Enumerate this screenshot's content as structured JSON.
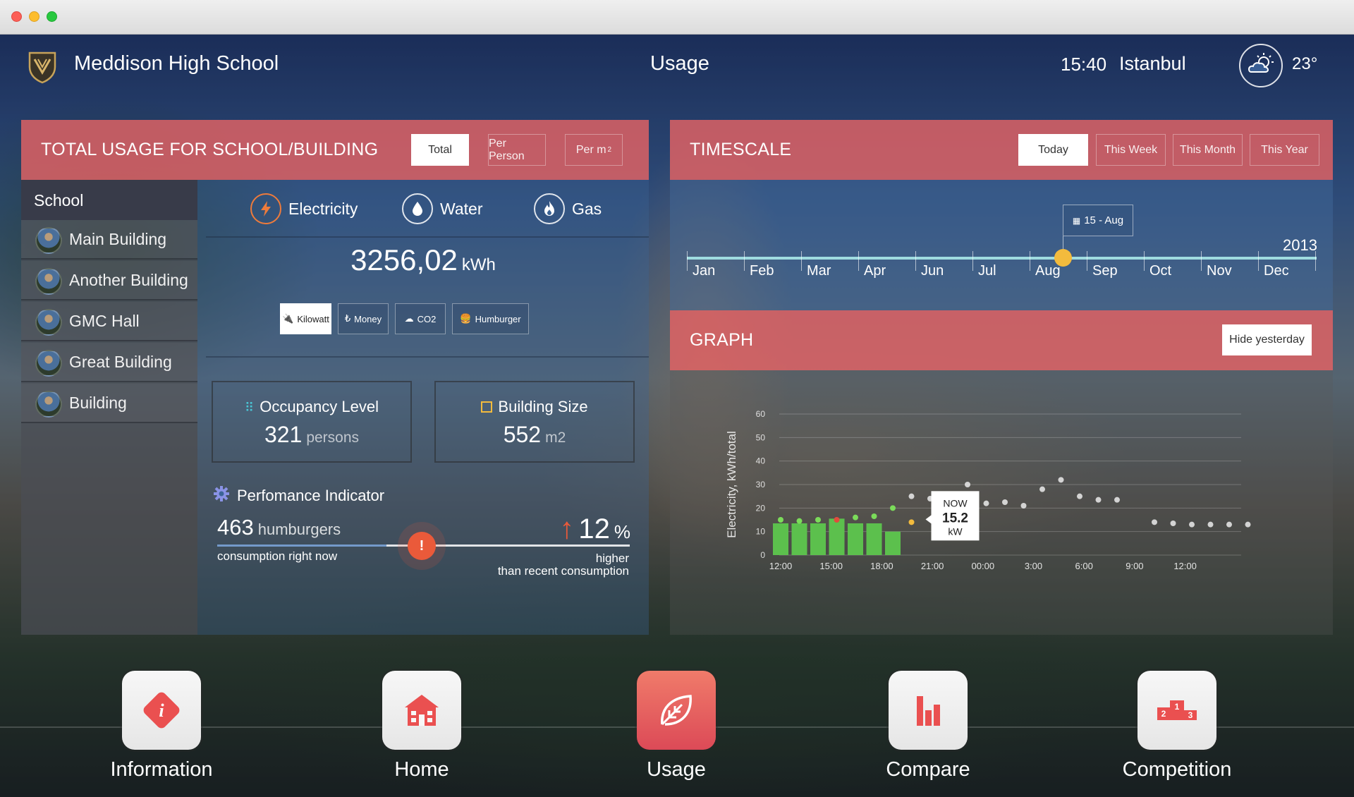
{
  "header": {
    "school_name": "Meddison High School",
    "page_title": "Usage",
    "time": "15:40",
    "city": "Istanbul",
    "temperature": "23°"
  },
  "total_usage": {
    "title": "TOTAL USAGE FOR SCHOOL/BUILDING",
    "tabs": [
      "Total",
      "Per Person",
      "Per m"
    ],
    "tab_superscript": "2",
    "active_tab": "Total"
  },
  "sidebar": {
    "header": "School",
    "items": [
      {
        "label": "Main Building"
      },
      {
        "label": "Another Building"
      },
      {
        "label": "GMC Hall"
      },
      {
        "label": "Great Building"
      },
      {
        "label": "Building"
      }
    ]
  },
  "resources": [
    {
      "label": "Electricity",
      "icon": "electricity-icon",
      "active": true
    },
    {
      "label": "Water",
      "icon": "water-drop-icon",
      "active": false
    },
    {
      "label": "Gas",
      "icon": "flame-icon",
      "active": false
    }
  ],
  "consumption": {
    "value": "3256,02",
    "unit": "kWh"
  },
  "unit_buttons": [
    "Kilowatt",
    "Money",
    "CO2",
    "Humburger"
  ],
  "occupancy": {
    "title": "Occupancy Level",
    "value": "321",
    "unit": "persons"
  },
  "building_size": {
    "title": "Building Size",
    "value": "552",
    "unit": "m2"
  },
  "performance": {
    "title": "Perfomance Indicator",
    "current_value": "463",
    "current_unit": "humburgers",
    "current_label": "consumption right now",
    "change_value": "12",
    "change_unit": "%",
    "change_label_1": "higher",
    "change_label_2": "than recent consumption",
    "marker_symbol": "!",
    "level_fraction": 0.41
  },
  "timescale": {
    "title": "TIMESCALE",
    "tabs": [
      "Today",
      "This Week",
      "This Month",
      "This Year"
    ],
    "active_tab": "Today",
    "selected_date": "15 - Aug",
    "year": "2013",
    "months": [
      "Jan",
      "Feb",
      "Mar",
      "Apr",
      "Jun",
      "Jul",
      "Aug",
      "Sep",
      "Oct",
      "Nov",
      "Dec"
    ],
    "selected_month": "Aug"
  },
  "graph": {
    "title": "GRAPH",
    "hide_button": "Hide yesterday",
    "now_label": "NOW",
    "now_value": "15.2",
    "now_unit": "kW"
  },
  "chart_data": {
    "type": "bar",
    "ylabel": "Electricity, kWh/total",
    "ylim": [
      0,
      60
    ],
    "y_ticks": [
      0,
      10,
      20,
      30,
      40,
      50,
      60
    ],
    "x_tick_labels": [
      "12:00",
      "15:00",
      "18:00",
      "21:00",
      "00:00",
      "3:00",
      "6:00",
      "9:00",
      "12:00"
    ],
    "bars": {
      "name": "today",
      "values": [
        13.5,
        13.5,
        13.5,
        15.5,
        13.5,
        13.5,
        10
      ],
      "color": "#5cc04d"
    },
    "today_points": [
      {
        "value": 15,
        "color": "#7bdc5a"
      },
      {
        "value": 14.5,
        "color": "#7bdc5a"
      },
      {
        "value": 15,
        "color": "#7bdc5a"
      },
      {
        "value": 15,
        "color": "#e14b3d"
      },
      {
        "value": 16,
        "color": "#7bdc5a"
      },
      {
        "value": 16.5,
        "color": "#7bdc5a"
      },
      {
        "value": 20,
        "color": "#7bdc5a"
      },
      {
        "value": 14,
        "color": "#f3bb3d"
      }
    ],
    "yesterday_points": [
      25,
      24,
      null,
      30,
      22,
      22.5,
      21,
      28,
      32,
      25,
      23.5,
      23.5,
      null,
      14,
      13.5,
      13,
      13,
      13,
      13
    ],
    "now_value": 15.2
  },
  "bottom_nav": [
    {
      "label": "Information",
      "icon": "info-icon",
      "active": false
    },
    {
      "label": "Home",
      "icon": "home-icon",
      "active": false
    },
    {
      "label": "Usage",
      "icon": "leaf-icon",
      "active": true
    },
    {
      "label": "Compare",
      "icon": "bar-chart-icon",
      "active": false
    },
    {
      "label": "Competition",
      "icon": "podium-icon",
      "active": false
    }
  ],
  "colors": {
    "accent_red": "#e46364",
    "accent_orange": "#ef7b3b",
    "knob_yellow": "#f3bb3d",
    "bar_green": "#5cc04d"
  }
}
